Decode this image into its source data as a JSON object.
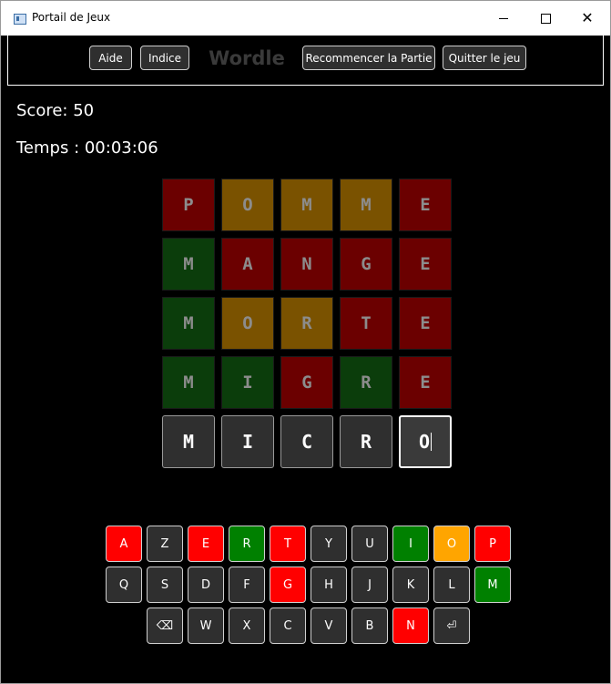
{
  "window": {
    "title": "Portail de Jeux"
  },
  "toolbar": {
    "help_label": "Aide",
    "hint_label": "Indice",
    "game_title": "Wordle",
    "restart_label": "Recommencer la Partie",
    "quit_label": "Quitter le jeu"
  },
  "status": {
    "score": "Score: 50",
    "time": "Temps : 00:03:06"
  },
  "colors": {
    "correct": "#0b3d0b",
    "present": "#7a5200",
    "absent": "#6b0000",
    "key_correct": "#008000",
    "key_present": "#ffa500",
    "key_absent": "#ff0000",
    "key_default": "#2f2f2f"
  },
  "grid": {
    "rows": [
      [
        {
          "letter": "P",
          "state": "absent"
        },
        {
          "letter": "O",
          "state": "present"
        },
        {
          "letter": "M",
          "state": "present"
        },
        {
          "letter": "M",
          "state": "present"
        },
        {
          "letter": "E",
          "state": "absent"
        }
      ],
      [
        {
          "letter": "M",
          "state": "correct"
        },
        {
          "letter": "A",
          "state": "absent"
        },
        {
          "letter": "N",
          "state": "absent"
        },
        {
          "letter": "G",
          "state": "absent"
        },
        {
          "letter": "E",
          "state": "absent"
        }
      ],
      [
        {
          "letter": "M",
          "state": "correct"
        },
        {
          "letter": "O",
          "state": "present"
        },
        {
          "letter": "R",
          "state": "present"
        },
        {
          "letter": "T",
          "state": "absent"
        },
        {
          "letter": "E",
          "state": "absent"
        }
      ],
      [
        {
          "letter": "M",
          "state": "correct"
        },
        {
          "letter": "I",
          "state": "correct"
        },
        {
          "letter": "G",
          "state": "absent"
        },
        {
          "letter": "R",
          "state": "correct"
        },
        {
          "letter": "E",
          "state": "absent"
        }
      ]
    ],
    "current_input": [
      "M",
      "I",
      "C",
      "R",
      "O"
    ]
  },
  "keyboard": {
    "rows": [
      [
        {
          "label": "A",
          "state": "absent"
        },
        {
          "label": "Z",
          "state": "default"
        },
        {
          "label": "E",
          "state": "absent"
        },
        {
          "label": "R",
          "state": "correct"
        },
        {
          "label": "T",
          "state": "absent"
        },
        {
          "label": "Y",
          "state": "default"
        },
        {
          "label": "U",
          "state": "default"
        },
        {
          "label": "I",
          "state": "correct"
        },
        {
          "label": "O",
          "state": "present"
        },
        {
          "label": "P",
          "state": "absent"
        }
      ],
      [
        {
          "label": "Q",
          "state": "default"
        },
        {
          "label": "S",
          "state": "default"
        },
        {
          "label": "D",
          "state": "default"
        },
        {
          "label": "F",
          "state": "default"
        },
        {
          "label": "G",
          "state": "absent"
        },
        {
          "label": "H",
          "state": "default"
        },
        {
          "label": "J",
          "state": "default"
        },
        {
          "label": "K",
          "state": "default"
        },
        {
          "label": "L",
          "state": "default"
        },
        {
          "label": "M",
          "state": "correct"
        }
      ],
      [
        {
          "label": "⌫",
          "state": "default",
          "icon": "backspace-icon"
        },
        {
          "label": "W",
          "state": "default"
        },
        {
          "label": "X",
          "state": "default"
        },
        {
          "label": "C",
          "state": "default"
        },
        {
          "label": "V",
          "state": "default"
        },
        {
          "label": "B",
          "state": "default"
        },
        {
          "label": "N",
          "state": "absent"
        },
        {
          "label": "⏎",
          "state": "default",
          "icon": "enter-icon"
        }
      ]
    ]
  }
}
